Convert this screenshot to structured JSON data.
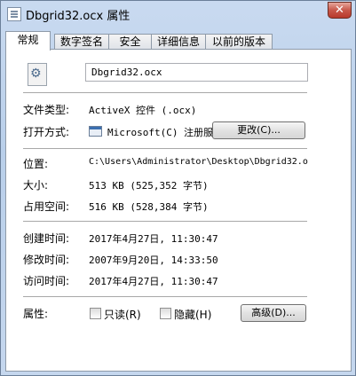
{
  "window": {
    "title": "Dbgrid32.ocx 属性",
    "close_glyph": "✕"
  },
  "tabs": [
    {
      "label": "常规",
      "active": true
    },
    {
      "label": "数字签名",
      "active": false
    },
    {
      "label": "安全",
      "active": false
    },
    {
      "label": "详细信息",
      "active": false
    },
    {
      "label": "以前的版本",
      "active": false
    }
  ],
  "general": {
    "file_name": "Dbgrid32.ocx",
    "file_type_label": "文件类型:",
    "file_type_value": "ActiveX 控件 (.ocx)",
    "open_with_label": "打开方式:",
    "open_with_value": "Microsoft(C) 注册服",
    "change_button": "更改(C)...",
    "location_label": "位置:",
    "location_value": "C:\\Users\\Administrator\\Desktop\\Dbgrid32.o",
    "size_label": "大小:",
    "size_value": "513 KB (525,352 字节)",
    "size_on_disk_label": "占用空间:",
    "size_on_disk_value": "516 KB (528,384 字节)",
    "created_label": "创建时间:",
    "created_value": "2017年4月27日, 11:30:47",
    "modified_label": "修改时间:",
    "modified_value": "2007年9月20日, 14:33:50",
    "accessed_label": "访问时间:",
    "accessed_value": "2017年4月27日, 11:30:47",
    "attributes_label": "属性:",
    "readonly_label": "只读(R)",
    "readonly_checked": false,
    "hidden_label": "隐藏(H)",
    "hidden_checked": false,
    "advanced_button": "高级(D)..."
  }
}
